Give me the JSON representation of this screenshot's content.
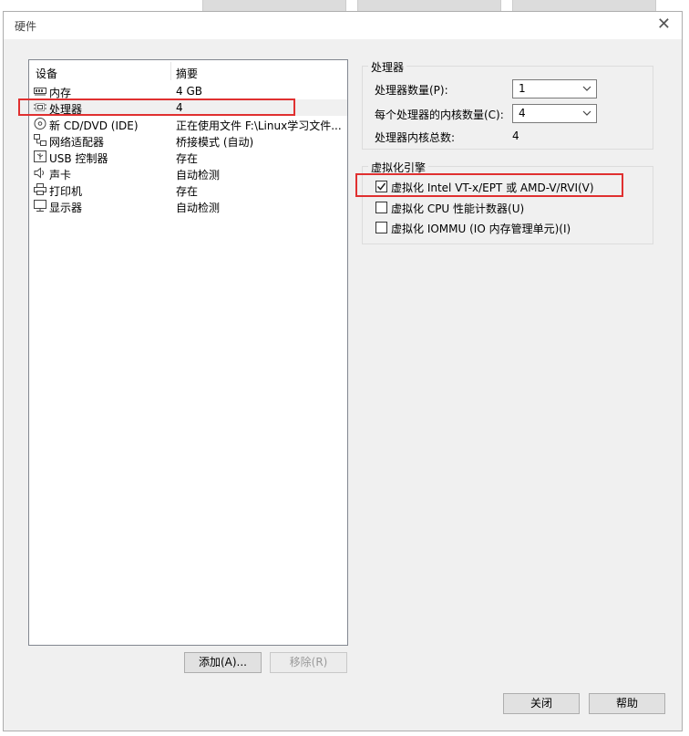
{
  "window": {
    "title": "硬件"
  },
  "devices": {
    "header_device": "设备",
    "header_summary": "摘要",
    "items": [
      {
        "icon": "memory-icon",
        "name": "内存",
        "summary": "4 GB"
      },
      {
        "icon": "processor-icon",
        "name": "处理器",
        "summary": "4"
      },
      {
        "icon": "cd-dvd-icon",
        "name": "新 CD/DVD (IDE)",
        "summary": "正在使用文件 F:\\Linux学习文件..."
      },
      {
        "icon": "network-adapter-icon",
        "name": "网络适配器",
        "summary": "桥接模式 (自动)"
      },
      {
        "icon": "usb-controller-icon",
        "name": "USB 控制器",
        "summary": "存在"
      },
      {
        "icon": "sound-card-icon",
        "name": "声卡",
        "summary": "自动检测"
      },
      {
        "icon": "printer-icon",
        "name": "打印机",
        "summary": "存在"
      },
      {
        "icon": "display-icon",
        "name": "显示器",
        "summary": "自动检测"
      }
    ],
    "selected_index": 1
  },
  "buttons": {
    "add": "添加(A)...",
    "remove": "移除(R)",
    "close": "关闭",
    "help": "帮助"
  },
  "processor": {
    "group_title": "处理器",
    "count_label": "处理器数量(P):",
    "count_value": "1",
    "cores_label": "每个处理器的内核数量(C):",
    "cores_value": "4",
    "total_label": "处理器内核总数:",
    "total_value": "4"
  },
  "virtualization": {
    "group_title": "虚拟化引擎",
    "options": [
      {
        "label": "虚拟化 Intel VT-x/EPT 或 AMD-V/RVI(V)",
        "checked": true
      },
      {
        "label": "虚拟化 CPU 性能计数器(U)",
        "checked": false
      },
      {
        "label": "虚拟化 IOMMU (IO 内存管理单元)(I)",
        "checked": false
      }
    ]
  },
  "colors": {
    "highlight": "#e03030",
    "selection": "#f0f0f0"
  }
}
